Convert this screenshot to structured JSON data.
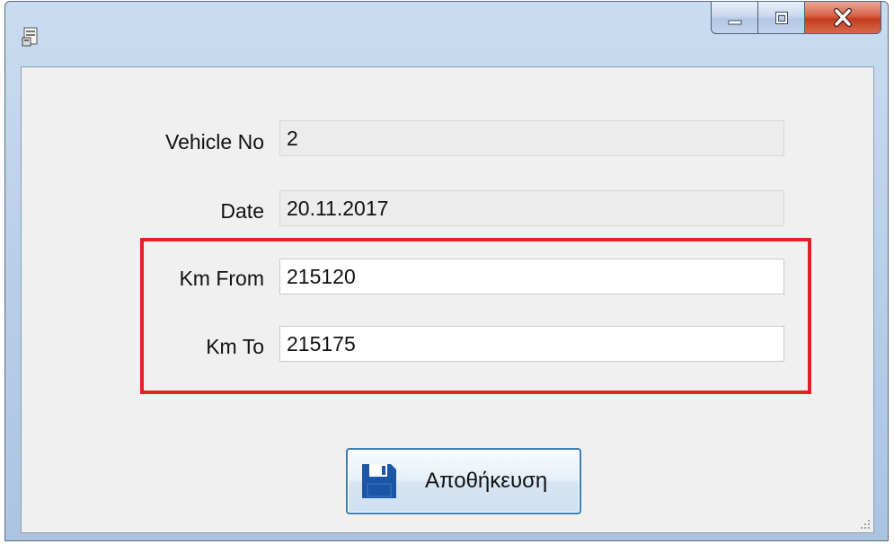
{
  "window": {
    "title": ""
  },
  "form": {
    "vehicle_no": {
      "label": "Vehicle No",
      "value": "2"
    },
    "date": {
      "label": "Date",
      "value": "20.11.2017"
    },
    "km_from": {
      "label": "Km From",
      "value": "215120"
    },
    "km_to": {
      "label": "Km To",
      "value": "215175"
    }
  },
  "save_button": {
    "label": "Αποθήκευση",
    "icon": "floppy-disk-icon"
  },
  "colors": {
    "highlight": "#e8202a",
    "save_icon": "#1b56a6",
    "close_button": "#c43b20"
  }
}
